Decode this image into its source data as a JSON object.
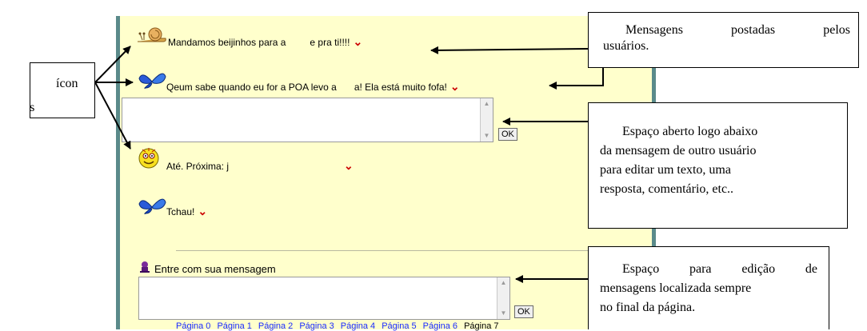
{
  "messages": [
    {
      "icon": "snail-icon",
      "text": "Mandamos beijinhos para a",
      "text2": "e pra ti!!!!"
    },
    {
      "icon": "butterfly-icon",
      "text": "Qeum sabe quando eu for a POA levo a",
      "text2": "a! Ela está muito fofa!"
    },
    {
      "icon": "smiley-icon",
      "text": "Até. Próxima: j"
    },
    {
      "icon": "butterfly-icon",
      "text": "Tchau!"
    }
  ],
  "reply_ok": "OK",
  "composer": {
    "label": "Entre com sua mensagem",
    "ok": "OK",
    "icon": "person-icon"
  },
  "pager": {
    "pages": [
      "Página 0",
      "Página 1",
      "Página 2",
      "Página 3",
      "Página 4",
      "Página 5",
      "Página 6"
    ],
    "current": "Página 7"
  },
  "callouts": {
    "icons": {
      "line1": "ícon",
      "line2": "es"
    },
    "messages": {
      "line1a": "Mensagens",
      "line1b": "postadas",
      "line1c": "pelos",
      "line2": "usuários."
    },
    "reply": {
      "line1": "Espaço aberto logo abaixo",
      "line2": "da mensagem de outro usuário",
      "line3": "para editar um texto, uma",
      "line4": "resposta, comentário, etc.."
    },
    "composer": {
      "line1a": "Espaço",
      "line1b": "para",
      "line1c": "edição",
      "line1d": "de",
      "line2": "mensagens localizada sempre",
      "line3": "no final da página."
    }
  }
}
